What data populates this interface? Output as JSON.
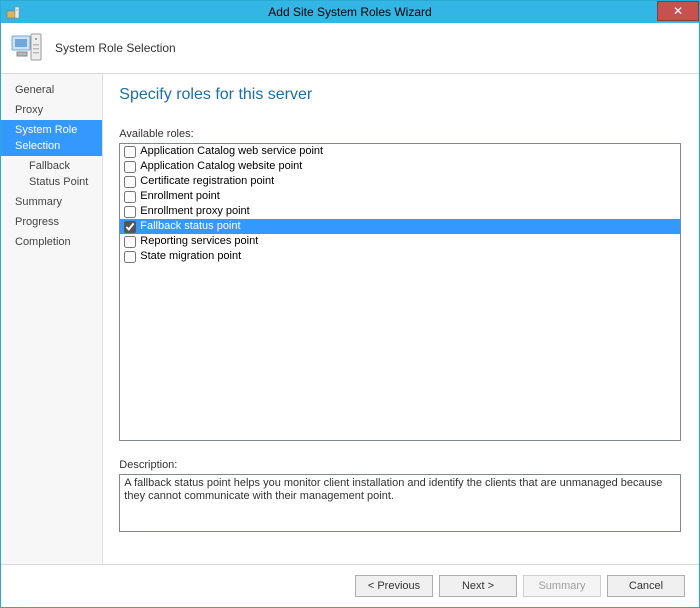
{
  "window": {
    "title": "Add Site System Roles Wizard"
  },
  "header": {
    "page_title": "System Role Selection"
  },
  "sidebar": {
    "items": [
      {
        "label": "General",
        "selected": false,
        "sub": false
      },
      {
        "label": "Proxy",
        "selected": false,
        "sub": false
      },
      {
        "label": "System Role Selection",
        "selected": true,
        "sub": false
      },
      {
        "label": "Fallback Status Point",
        "selected": false,
        "sub": true
      },
      {
        "label": "Summary",
        "selected": false,
        "sub": false
      },
      {
        "label": "Progress",
        "selected": false,
        "sub": false
      },
      {
        "label": "Completion",
        "selected": false,
        "sub": false
      }
    ]
  },
  "main": {
    "heading": "Specify roles for this server",
    "available_label": "Available roles:",
    "roles": [
      {
        "label": "Application Catalog web service point",
        "checked": false,
        "selected": false
      },
      {
        "label": "Application Catalog website point",
        "checked": false,
        "selected": false
      },
      {
        "label": "Certificate registration point",
        "checked": false,
        "selected": false
      },
      {
        "label": "Enrollment point",
        "checked": false,
        "selected": false
      },
      {
        "label": "Enrollment proxy point",
        "checked": false,
        "selected": false
      },
      {
        "label": "Fallback status point",
        "checked": true,
        "selected": true
      },
      {
        "label": "Reporting services point",
        "checked": false,
        "selected": false
      },
      {
        "label": "State migration point",
        "checked": false,
        "selected": false
      }
    ],
    "description_label": "Description:",
    "description_text": "A fallback status point helps you monitor client installation and identify the clients that are unmanaged because they cannot communicate with their management point."
  },
  "footer": {
    "previous": "< Previous",
    "next": "Next >",
    "summary": "Summary",
    "cancel": "Cancel",
    "summary_enabled": false
  }
}
